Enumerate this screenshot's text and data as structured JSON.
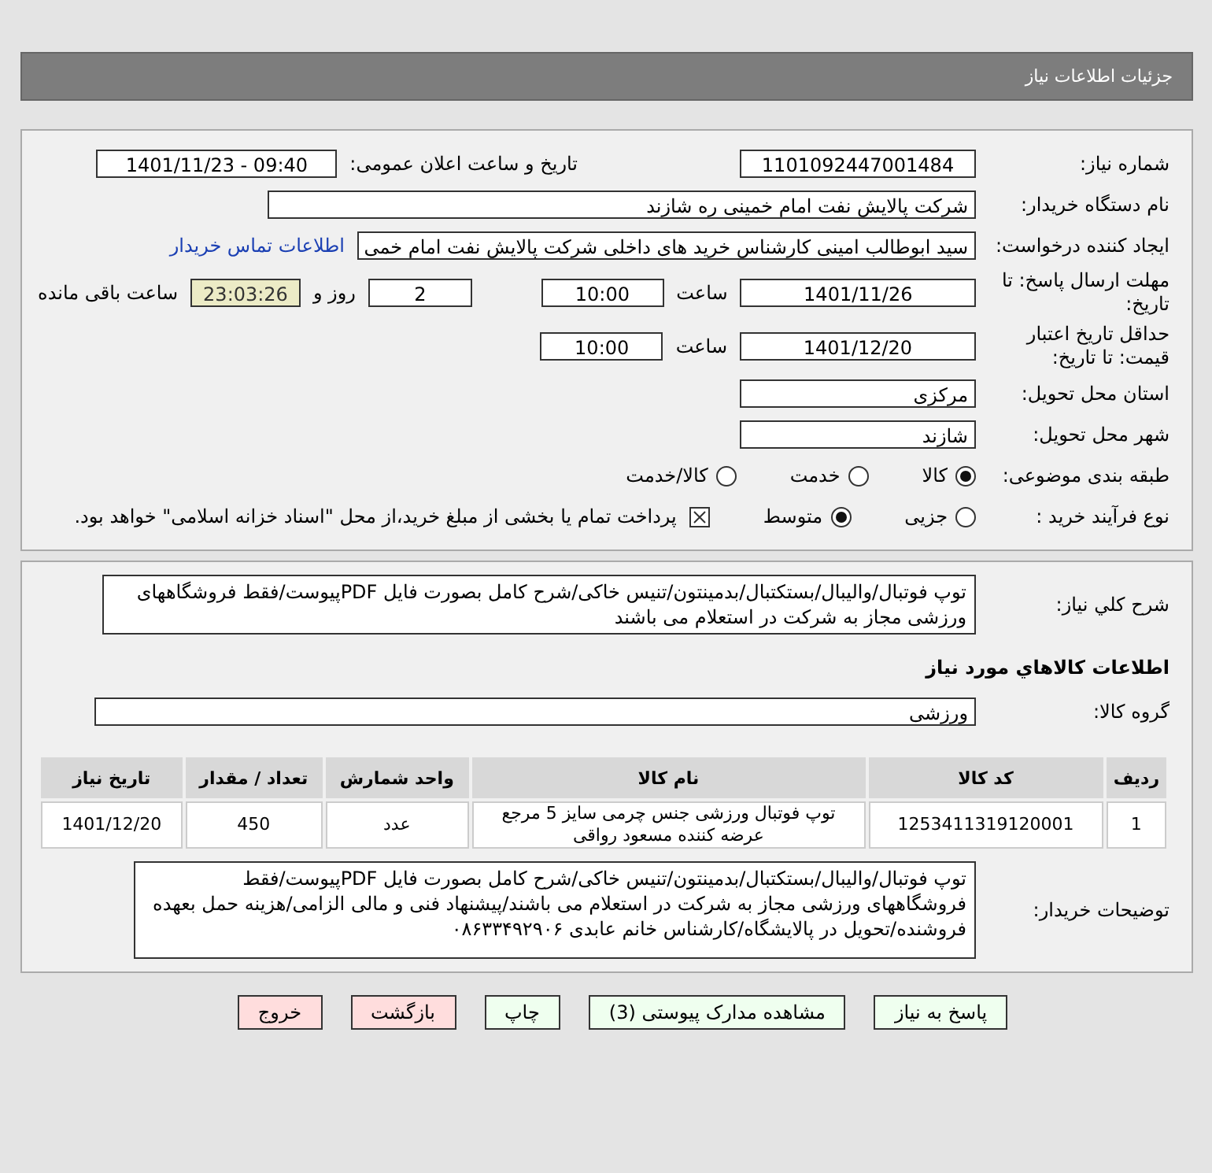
{
  "window": {
    "title": "جزئیات اطلاعات نیاز"
  },
  "need_number": {
    "label": "شماره نیاز:",
    "value": "1101092447001484"
  },
  "announce": {
    "label": "تاریخ و ساعت اعلان عمومی:",
    "value": "1401/11/23 - 09:40"
  },
  "buyer": {
    "label": "نام دستگاه خریدار:",
    "value": "شرکت پالایش نفت امام خمینی  ره  شازند"
  },
  "requester": {
    "label": "ایجاد کننده درخواست:",
    "value": "سید ابوطالب  امینی کارشناس خرید های داخلی  شرکت پالایش نفت امام خمی",
    "link": "اطلاعات تماس خریدار"
  },
  "reply_deadline": {
    "label": "مهلت ارسال پاسخ: تا تاریخ:",
    "date": "1401/11/26",
    "time_label": "ساعت",
    "time": "10:00",
    "days": "2",
    "days_label": "روز و",
    "remaining": "23:03:26",
    "remaining_label": "ساعت باقی مانده"
  },
  "price_validity": {
    "label": "حداقل تاریخ اعتبار قیمت: تا تاریخ:",
    "date": "1401/12/20",
    "time_label": "ساعت",
    "time": "10:00"
  },
  "province": {
    "label": "استان محل تحویل:",
    "value": "مرکزی"
  },
  "city": {
    "label": "شهر محل تحویل:",
    "value": "شازند"
  },
  "category": {
    "label": "طبقه بندی موضوعی:",
    "options": [
      {
        "label": "کالا",
        "selected": true
      },
      {
        "label": "خدمت",
        "selected": false
      },
      {
        "label": "کالا/خدمت",
        "selected": false
      }
    ]
  },
  "process": {
    "label": "نوع فرآیند خرید :",
    "options": [
      {
        "label": "جزیی",
        "selected": false
      },
      {
        "label": "متوسط",
        "selected": true
      }
    ],
    "payment": {
      "checked": true,
      "text": "پرداخت تمام یا بخشی از مبلغ خرید،از محل \"اسناد خزانه اسلامی\" خواهد بود."
    }
  },
  "description": {
    "label": "شرح کلي نیاز:",
    "text": "توپ فوتبال/والیبال/بستکتبال/بدمینتون/تنیس خاکی/شرح کامل بصورت فایل PDFپیوست/فقط فروشگاههای ورزشی مجاز به شرکت در استعلام می باشند"
  },
  "goods_title": "اطلاعات کالاهاي مورد نیاز",
  "goods_group": {
    "label": "گروه کالا:",
    "value": "ورزشی"
  },
  "table": {
    "columns": [
      "ردیف",
      "کد کالا",
      "نام کالا",
      "واحد شمارش",
      "تعداد / مقدار",
      "تاریخ نیاز"
    ],
    "rows": [
      [
        "1",
        "1253411319120001",
        "توپ فوتبال ورزشی جنس چرمی سایز 5 مرجع عرضه کننده مسعود رواقی",
        "عدد",
        "450",
        "1401/12/20"
      ]
    ]
  },
  "buyer_notes": {
    "label": "توضیحات خریدار:",
    "text": "توپ فوتبال/والیبال/بستکتبال/بدمینتون/تنیس خاکی/شرح کامل بصورت فایل PDFپیوست/فقط فروشگاههای ورزشی مجاز به شرکت در استعلام می باشند/پیشنهاد فنی و مالی الزامی/هزینه حمل بعهده فروشنده/تحویل در پالایشگاه/کارشناس خانم عابدی ۰۸۶۳۳۴۹۲۹۰۶"
  },
  "buttons": [
    {
      "label": "پاسخ به نیاز",
      "kind": "normal"
    },
    {
      "label": "مشاهده مدارک پیوستی (3)",
      "kind": "normal"
    },
    {
      "label": "چاپ",
      "kind": "normal"
    },
    {
      "label": "بازگشت",
      "kind": "danger"
    },
    {
      "label": "خروج",
      "kind": "danger"
    }
  ]
}
